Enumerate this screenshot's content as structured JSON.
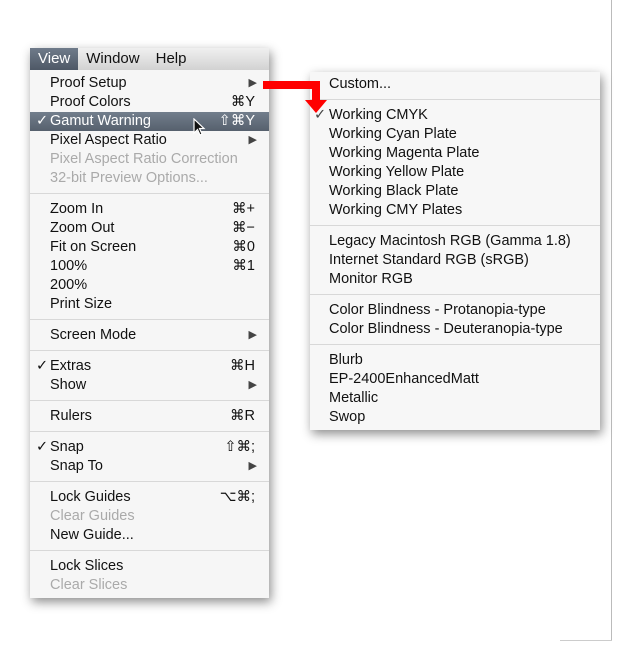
{
  "menubar": {
    "items": [
      "View",
      "Window",
      "Help"
    ],
    "active": "View"
  },
  "view_menu": {
    "groups": [
      [
        {
          "label": "Proof Setup",
          "submenu": true
        },
        {
          "label": "Proof Colors",
          "shortcut": "⌘Y"
        },
        {
          "label": "Gamut Warning",
          "shortcut": "⇧⌘Y",
          "checked": true,
          "highlighted": true
        },
        {
          "label": "Pixel Aspect Ratio",
          "submenu": true
        },
        {
          "label": "Pixel Aspect Ratio Correction",
          "disabled": true
        },
        {
          "label": "32-bit Preview Options...",
          "disabled": true
        }
      ],
      [
        {
          "label": "Zoom In",
          "shortcut": "⌘+"
        },
        {
          "label": "Zoom Out",
          "shortcut": "⌘−"
        },
        {
          "label": "Fit on Screen",
          "shortcut": "⌘0"
        },
        {
          "label": "100%",
          "shortcut": "⌘1"
        },
        {
          "label": "200%"
        },
        {
          "label": "Print Size"
        }
      ],
      [
        {
          "label": "Screen Mode",
          "submenu": true
        }
      ],
      [
        {
          "label": "Extras",
          "shortcut": "⌘H",
          "checked": true
        },
        {
          "label": "Show",
          "submenu": true
        }
      ],
      [
        {
          "label": "Rulers",
          "shortcut": "⌘R"
        }
      ],
      [
        {
          "label": "Snap",
          "shortcut": "⇧⌘;",
          "checked": true
        },
        {
          "label": "Snap To",
          "submenu": true
        }
      ],
      [
        {
          "label": "Lock Guides",
          "shortcut": "⌥⌘;"
        },
        {
          "label": "Clear Guides",
          "disabled": true
        },
        {
          "label": "New Guide..."
        }
      ],
      [
        {
          "label": "Lock Slices"
        },
        {
          "label": "Clear Slices",
          "disabled": true
        }
      ]
    ]
  },
  "proof_setup_submenu": {
    "groups": [
      [
        {
          "label": "Custom..."
        }
      ],
      [
        {
          "label": "Working CMYK",
          "checked": true
        },
        {
          "label": "Working Cyan Plate"
        },
        {
          "label": "Working Magenta Plate"
        },
        {
          "label": "Working Yellow Plate"
        },
        {
          "label": "Working Black Plate"
        },
        {
          "label": "Working CMY Plates"
        }
      ],
      [
        {
          "label": "Legacy Macintosh RGB (Gamma 1.8)"
        },
        {
          "label": "Internet Standard RGB (sRGB)"
        },
        {
          "label": "Monitor RGB"
        }
      ],
      [
        {
          "label": "Color Blindness - Protanopia-type"
        },
        {
          "label": "Color Blindness - Deuteranopia-type"
        }
      ],
      [
        {
          "label": "Blurb"
        },
        {
          "label": "EP-2400EnhancedMatt"
        },
        {
          "label": "Metallic"
        },
        {
          "label": "Swop"
        }
      ]
    ]
  },
  "icons": {
    "check": "✓",
    "submenu_arrow": "▶",
    "cursor": "arrow-pointer-icon"
  },
  "colors": {
    "callout_arrow": "#ff0000",
    "highlight": "#5f6a78"
  }
}
